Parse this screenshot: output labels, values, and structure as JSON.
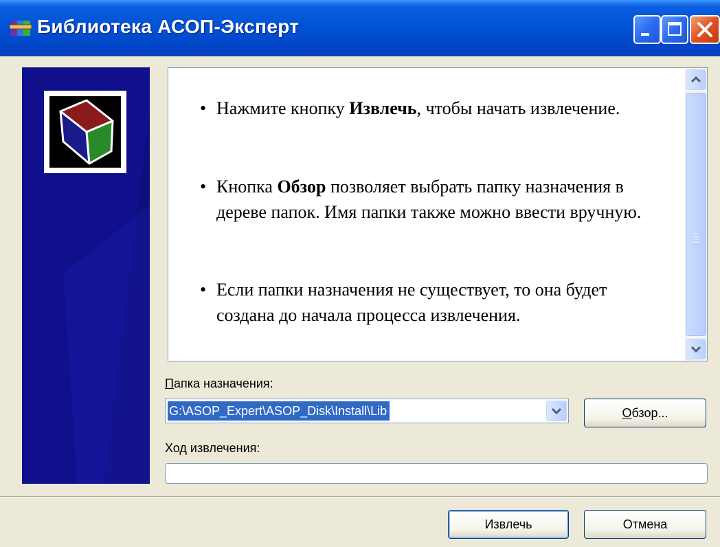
{
  "window": {
    "title": "Библиотека АСОП-Эксперт",
    "icon": "winrar-archive-icon"
  },
  "title_buttons": [
    "minimize-icon",
    "maximize-icon",
    "close-icon"
  ],
  "instructions": [
    {
      "before": "Нажмите кнопку ",
      "bold": "Извлечь",
      "after": ", чтобы начать извлечение."
    },
    {
      "before": "Кнопка ",
      "bold": "Обзор",
      "after": " позволяет выбрать папку назначения в дереве папок. Имя папки также можно ввести вручную."
    },
    {
      "before": "",
      "bold": "",
      "after": "Если папки назначения не существует, то она будет создана до начала процесса извлечения."
    }
  ],
  "destination": {
    "label_accel": "П",
    "label_rest": "апка назначения:",
    "value": "G:\\ASOP_Expert\\ASOP_Disk\\Install\\Lib"
  },
  "progress": {
    "label": "Ход извлечения:",
    "value": 0
  },
  "buttons": {
    "browse_accel": "О",
    "browse_rest": "бзор...",
    "extract": "Извлечь",
    "cancel": "Отмена"
  },
  "colors": {
    "titlebar": "#0252d6",
    "sidepanel": "#0e0f7c",
    "selection": "#316ac5"
  }
}
